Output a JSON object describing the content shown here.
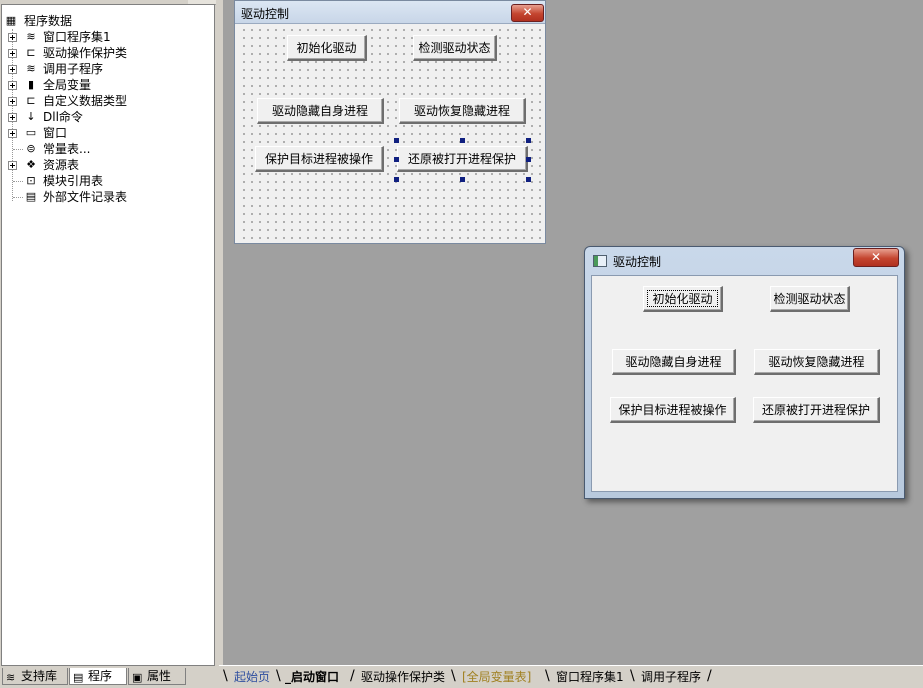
{
  "tree": {
    "root": "程序数据",
    "items": [
      {
        "label": "窗口程序集1",
        "icon": "stack-icon"
      },
      {
        "label": "驱动操作保护类",
        "icon": "class-icon"
      },
      {
        "label": "调用子程序",
        "icon": "stack-icon"
      },
      {
        "label": "全局变量",
        "icon": "variable-icon"
      },
      {
        "label": "自定义数据类型",
        "icon": "class-icon"
      },
      {
        "label": "Dll命令",
        "icon": "dll-icon"
      },
      {
        "label": "窗口",
        "icon": "window-icon"
      },
      {
        "label": "常量表...",
        "icon": "constant-icon"
      },
      {
        "label": "资源表",
        "icon": "resource-icon"
      },
      {
        "label": "模块引用表",
        "icon": "module-icon"
      },
      {
        "label": "外部文件记录表",
        "icon": "file-icon"
      }
    ]
  },
  "left_tabs": [
    {
      "label": "支持库",
      "icon": "library-icon"
    },
    {
      "label": "程序",
      "icon": "program-icon"
    },
    {
      "label": "属性",
      "icon": "property-icon"
    }
  ],
  "design_form": {
    "title": "驱动控制",
    "buttons": {
      "init": "初始化驱动",
      "check": "检测驱动状态",
      "hide": "驱动隐藏自身进程",
      "restore": "驱动恢复隐藏进程",
      "protect": "保护目标进程被操作",
      "restore_open": "还原被打开进程保护"
    }
  },
  "run_window": {
    "title": "驱动控制",
    "buttons": {
      "init": "初始化驱动",
      "check": "检测驱动状态",
      "hide": "驱动隐藏自身进程",
      "restore": "驱动恢复隐藏进程",
      "protect": "保护目标进程被操作",
      "restore_open": "还原被打开进程保护"
    }
  },
  "bottom_tabs": [
    "起始页",
    "_启动窗口",
    "驱动操作保护类",
    "[全局变量表]",
    "窗口程序集1",
    "调用子程序"
  ],
  "colors": {
    "tab_start": "#3050a0",
    "tab_global": "#a08020"
  }
}
